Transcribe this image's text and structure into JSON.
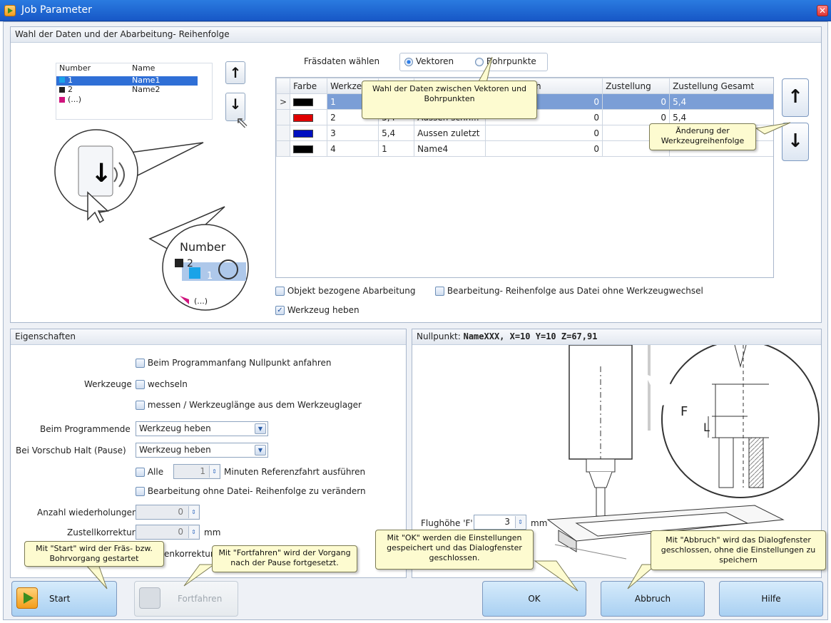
{
  "window": {
    "title": "Job Parameter"
  },
  "top_panel": {
    "title": "Wahl der Daten und der Abarbeitung- Reihenfolge",
    "mini_table": {
      "headers": [
        "Number",
        "Name"
      ],
      "rows": [
        [
          "1",
          "Name1"
        ],
        [
          "2",
          "Name2"
        ],
        [
          "(...)",
          ""
        ]
      ]
    },
    "zoom_header": "Number",
    "zoom_row_1": "2",
    "zoom_row_2": "1",
    "zoom_row_3": "(...)",
    "fraesdaten_label": "Fräsdaten wählen",
    "radio_vektoren": "Vektoren",
    "radio_bohrpunkte": "Bohrpunkte",
    "grid": {
      "headers": [
        "",
        "Farbe",
        "Werkzeu",
        "",
        "",
        "wiederholen",
        "Zustellung",
        "Zustellung Gesamt"
      ],
      "rows": [
        {
          "marker": ">",
          "tool": "1",
          "diam": "",
          "name": "",
          "rep": "0",
          "zust": "0",
          "gesamt": "5,4"
        },
        {
          "marker": "",
          "tool": "2",
          "diam": "5,4",
          "name": "Aussen schn...",
          "rep": "0",
          "zust": "0",
          "gesamt": "5,4"
        },
        {
          "marker": "",
          "tool": "3",
          "diam": "5,4",
          "name": "Aussen zuletzt",
          "rep": "0",
          "zust": "",
          "gesamt": ""
        },
        {
          "marker": "",
          "tool": "4",
          "diam": "1",
          "name": "Name4",
          "rep": "0",
          "zust": "",
          "gesamt": ""
        }
      ]
    },
    "chk_objekt": "Objekt bezogene Abarbeitung",
    "chk_reihenfolge": "Bearbeitung- Reihenfolge aus Datei ohne Werkzeugwechsel",
    "chk_heben": "Werkzeug heben",
    "callout_daten": "Wahl der Daten zwischen Vektoren und Bohrpunkten",
    "callout_aenderung": "Änderung der Werkzeugreihenfolge"
  },
  "props": {
    "title": "Eigenschaften",
    "chk_nullpunkt": "Beim Programmanfang Nullpunkt anfahren",
    "werkzeuge_label": "Werkzeuge",
    "chk_wechseln": "wechseln",
    "chk_messen": "messen / Werkzeuglänge aus dem Werkzeuglager",
    "programmende_label": "Beim Programmende",
    "programmende_value": "Werkzeug heben",
    "vorschub_label": "Bei Vorschub Halt (Pause)",
    "vorschub_value": "Werkzeug heben",
    "chk_alle": "Alle",
    "alle_value": "1",
    "minuten_label": "Minuten Referenzfahrt ausführen",
    "chk_ohne_datei": "Bearbeitung ohne Datei- Reihenfolge zu verändern",
    "anzahl_label": "Anzahl wiederholungen",
    "anzahl_value": "0",
    "zustell_label": "Zustellkorrektur",
    "zustell_value": "0",
    "zustell_unit": "mm",
    "enkorrektur_label": "enkorrektur"
  },
  "nullpunkt": {
    "label": "Nullpunkt:",
    "value": "NameXXX, X=10 Y=10 Z=67,91",
    "diagram_F": "F",
    "diagram_L": "L",
    "flughoehe_label": "Flughöhe 'F'",
    "flughoehe_value": "3",
    "flughoehe_unit": "mm"
  },
  "callouts": {
    "start": "Mit \"Start\" wird der Fräs- bzw. Bohrvorgang gestartet",
    "fortfahren": "Mit \"Fortfahren\" wird der Vorgang nach der Pause fortgesetzt.",
    "ok": "Mit \"OK\" werden die Einstellungen gespeichert und das Dialogfenster geschlossen.",
    "abbruch": "Mit \"Abbruch\" wird das Dialogfenster geschlossen, ohne die Einstellungen zu speichern"
  },
  "buttons": {
    "start": "Start",
    "fortfahren": "Fortfahren",
    "ok": "OK",
    "abbruch": "Abbruch",
    "hilfe": "Hilfe"
  },
  "colors": {
    "tool1": "#000000",
    "tool2": "#e00000",
    "tool3": "#0010c0",
    "tool4": "#000000",
    "mini1": "#1aa3e8",
    "mini2": "#222222",
    "mini3": "#d0147e"
  }
}
